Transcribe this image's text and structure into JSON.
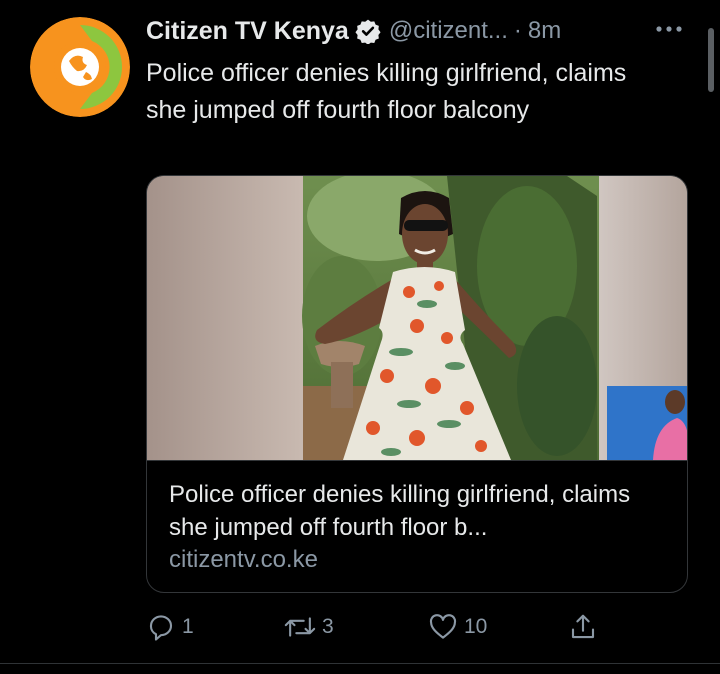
{
  "tweet": {
    "author_name": "Citizen TV Kenya",
    "author_handle": "@citizent...",
    "time_separator": "·",
    "time": "8m",
    "text": "Police officer denies killing girlfriend, claims she jumped off fourth floor balcony",
    "verified_icon": "verified-badge-icon",
    "more_icon": "more-options-icon"
  },
  "card": {
    "title": "Police officer denies killing girlfriend, claims she jumped off fourth floor b...",
    "domain": "citizentv.co.ke"
  },
  "actions": {
    "reply_count": "1",
    "retweet_count": "3",
    "like_count": "10"
  },
  "colors": {
    "background": "#000000",
    "text_primary": "#e7e9ea",
    "text_secondary": "#8b98a5",
    "border": "#333639",
    "brand_orange": "#f7931e",
    "brand_green": "#8dc63f"
  }
}
